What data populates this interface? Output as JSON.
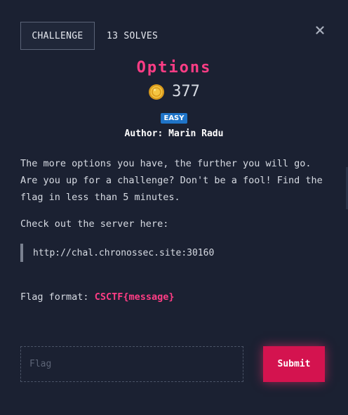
{
  "tabs": {
    "challenge_label": "CHALLENGE",
    "solves_label": "13 SOLVES"
  },
  "challenge": {
    "title": "Options",
    "points": "377",
    "difficulty": "EASY",
    "author": "Author: Marin Radu",
    "description": "The more options you have, the further you will go. Are you up for a challenge? Don't be a fool! Find the flag in less than 5 minutes.",
    "server_label": "Check out the server here:",
    "server_url": "http://chal.chronossec.site:30160",
    "flag_format_label": "Flag format:",
    "flag_format_value": "CSCTF{message}"
  },
  "form": {
    "flag_placeholder": "Flag",
    "flag_value": "",
    "submit_label": "Submit"
  },
  "icons": {
    "close": "close-icon",
    "coin": "coin-icon"
  },
  "colors": {
    "accent": "#ff3d85",
    "submit_bg": "#d4134f",
    "badge_bg": "#1f74c8",
    "background": "#1b2132"
  }
}
